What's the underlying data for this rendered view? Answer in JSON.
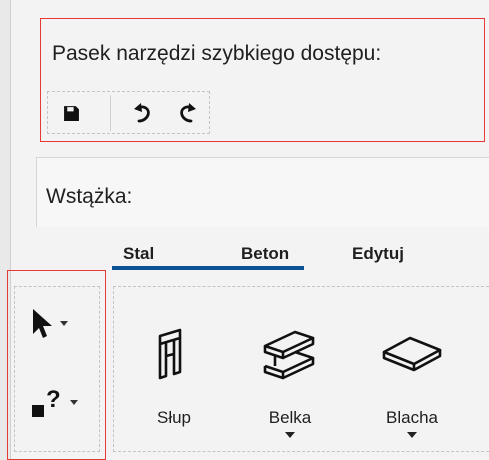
{
  "quick_access_toolbar": {
    "title": "Pasek narzędzi szybkiego dostępu:",
    "buttons": [
      {
        "name": "save",
        "icon": "save-icon"
      },
      {
        "name": "undo",
        "icon": "undo-icon"
      },
      {
        "name": "redo",
        "icon": "redo-icon"
      }
    ]
  },
  "ribbon": {
    "title": "Wstążka:",
    "tabs": [
      {
        "label": "Stal",
        "active": true
      },
      {
        "label": "Beton",
        "active": true
      },
      {
        "label": "Edytuj",
        "active": false
      }
    ],
    "tools": [
      {
        "name": "select",
        "icon": "arrow-pointer-icon"
      },
      {
        "name": "help",
        "icon": "question-mark-icon"
      }
    ],
    "objects": [
      {
        "label": "Słup",
        "icon": "column-icon",
        "has_dropdown": false
      },
      {
        "label": "Belka",
        "icon": "beam-icon",
        "has_dropdown": true
      },
      {
        "label": "Blacha",
        "icon": "plate-icon",
        "has_dropdown": true
      }
    ]
  },
  "colors": {
    "highlight": "#e53935",
    "tab_underline": "#0b5394",
    "panel_bg": "#f3f3f3"
  }
}
